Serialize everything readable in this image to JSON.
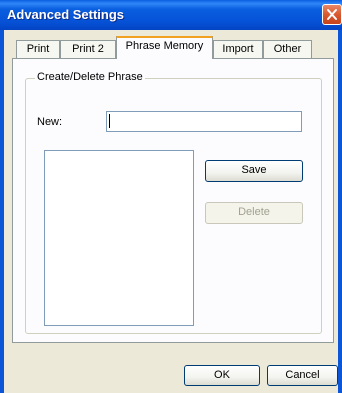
{
  "window": {
    "title": "Advanced Settings"
  },
  "tabs": [
    {
      "label": "Print",
      "active": false
    },
    {
      "label": "Print 2",
      "active": false
    },
    {
      "label": "Phrase Memory",
      "active": true
    },
    {
      "label": "Import",
      "active": false
    },
    {
      "label": "Other",
      "active": false
    }
  ],
  "group": {
    "title": "Create/Delete Phrase",
    "new_label": "New:",
    "new_value": "",
    "phrases": []
  },
  "buttons": {
    "save": "Save",
    "delete": "Delete",
    "ok": "OK",
    "cancel": "Cancel"
  },
  "colors": {
    "titlebar": "#0a5fe0",
    "close_button": "#d9592f",
    "dialog_background": "#ece9d8",
    "active_tab_highlight": "#f1a01f"
  },
  "icons": {
    "close": "close-icon"
  }
}
